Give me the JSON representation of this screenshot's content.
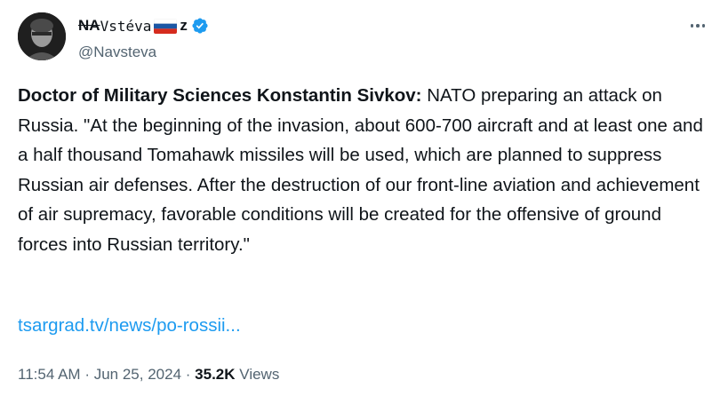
{
  "author": {
    "display_name_struck": "NA",
    "display_name_rest": "Vstéva",
    "display_name_tail": "z",
    "flag": "russia-flag",
    "verified": true,
    "handle": "@Navsteva"
  },
  "tweet": {
    "bold_lead": "Doctor of Military Sciences Konstantin Sivkov:",
    "body": " NATO preparing an attack on Russia. \"At the beginning of the invasion, about 600-700 aircraft and at least one and a half thousand Tomahawk missiles will be used, which are planned to suppress Russian air defenses. After the destruction of our front-line aviation and achievement of air supremacy, favorable conditions will be created for the offensive of ground forces into Russian territory.\"",
    "link_text": "tsargrad.tv/news/po-rossii..."
  },
  "meta": {
    "time": "11:54 AM",
    "separator": "·",
    "date": "Jun 25, 2024",
    "views_count": "35.2K",
    "views_label": "Views"
  },
  "colors": {
    "accent": "#1d9bf0",
    "text": "#0f1419",
    "secondary": "#536471"
  },
  "icons": {
    "more": "more-horizontal-icon",
    "verified": "verified-badge-icon"
  }
}
